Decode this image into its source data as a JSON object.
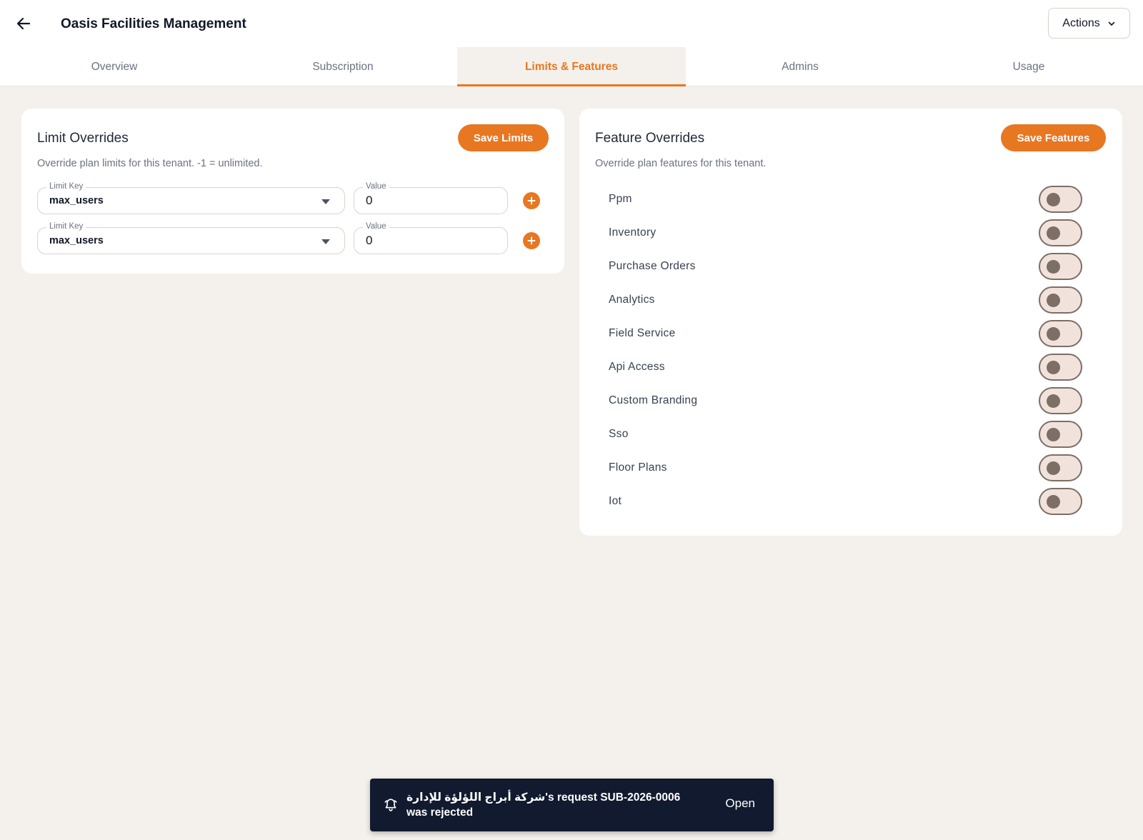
{
  "header": {
    "title": "Oasis Facilities Management",
    "actions_label": "Actions"
  },
  "tabs": [
    {
      "label": "Overview",
      "active": false
    },
    {
      "label": "Subscription",
      "active": false
    },
    {
      "label": "Limits & Features",
      "active": true
    },
    {
      "label": "Admins",
      "active": false
    },
    {
      "label": "Usage",
      "active": false
    }
  ],
  "limits": {
    "title": "Limit Overrides",
    "subtitle": "Override plan limits for this tenant. -1 = unlimited.",
    "save_label": "Save Limits",
    "rows": [
      {
        "key_label": "Limit Key",
        "key_value": "max_users",
        "value_label": "Value",
        "value": "0"
      },
      {
        "key_label": "Limit Key",
        "key_value": "max_users",
        "value_label": "Value",
        "value": "0"
      }
    ]
  },
  "features": {
    "title": "Feature Overrides",
    "subtitle": "Override plan features for this tenant.",
    "save_label": "Save Features",
    "items": [
      {
        "label": "Ppm",
        "enabled": false
      },
      {
        "label": "Inventory",
        "enabled": false
      },
      {
        "label": "Purchase Orders",
        "enabled": false
      },
      {
        "label": "Analytics",
        "enabled": false
      },
      {
        "label": "Field Service",
        "enabled": false
      },
      {
        "label": "Api Access",
        "enabled": false
      },
      {
        "label": "Custom Branding",
        "enabled": false
      },
      {
        "label": "Sso",
        "enabled": false
      },
      {
        "label": "Floor Plans",
        "enabled": false
      },
      {
        "label": "Iot",
        "enabled": false
      }
    ]
  },
  "snackbar": {
    "message": "شركة أبراج اللؤلؤة للإدارة's request SUB-2026-0006 was rejected",
    "action_label": "Open"
  },
  "colors": {
    "accent": "#e87722",
    "background": "#f4f0eb",
    "snackbar": "#111a2e"
  }
}
